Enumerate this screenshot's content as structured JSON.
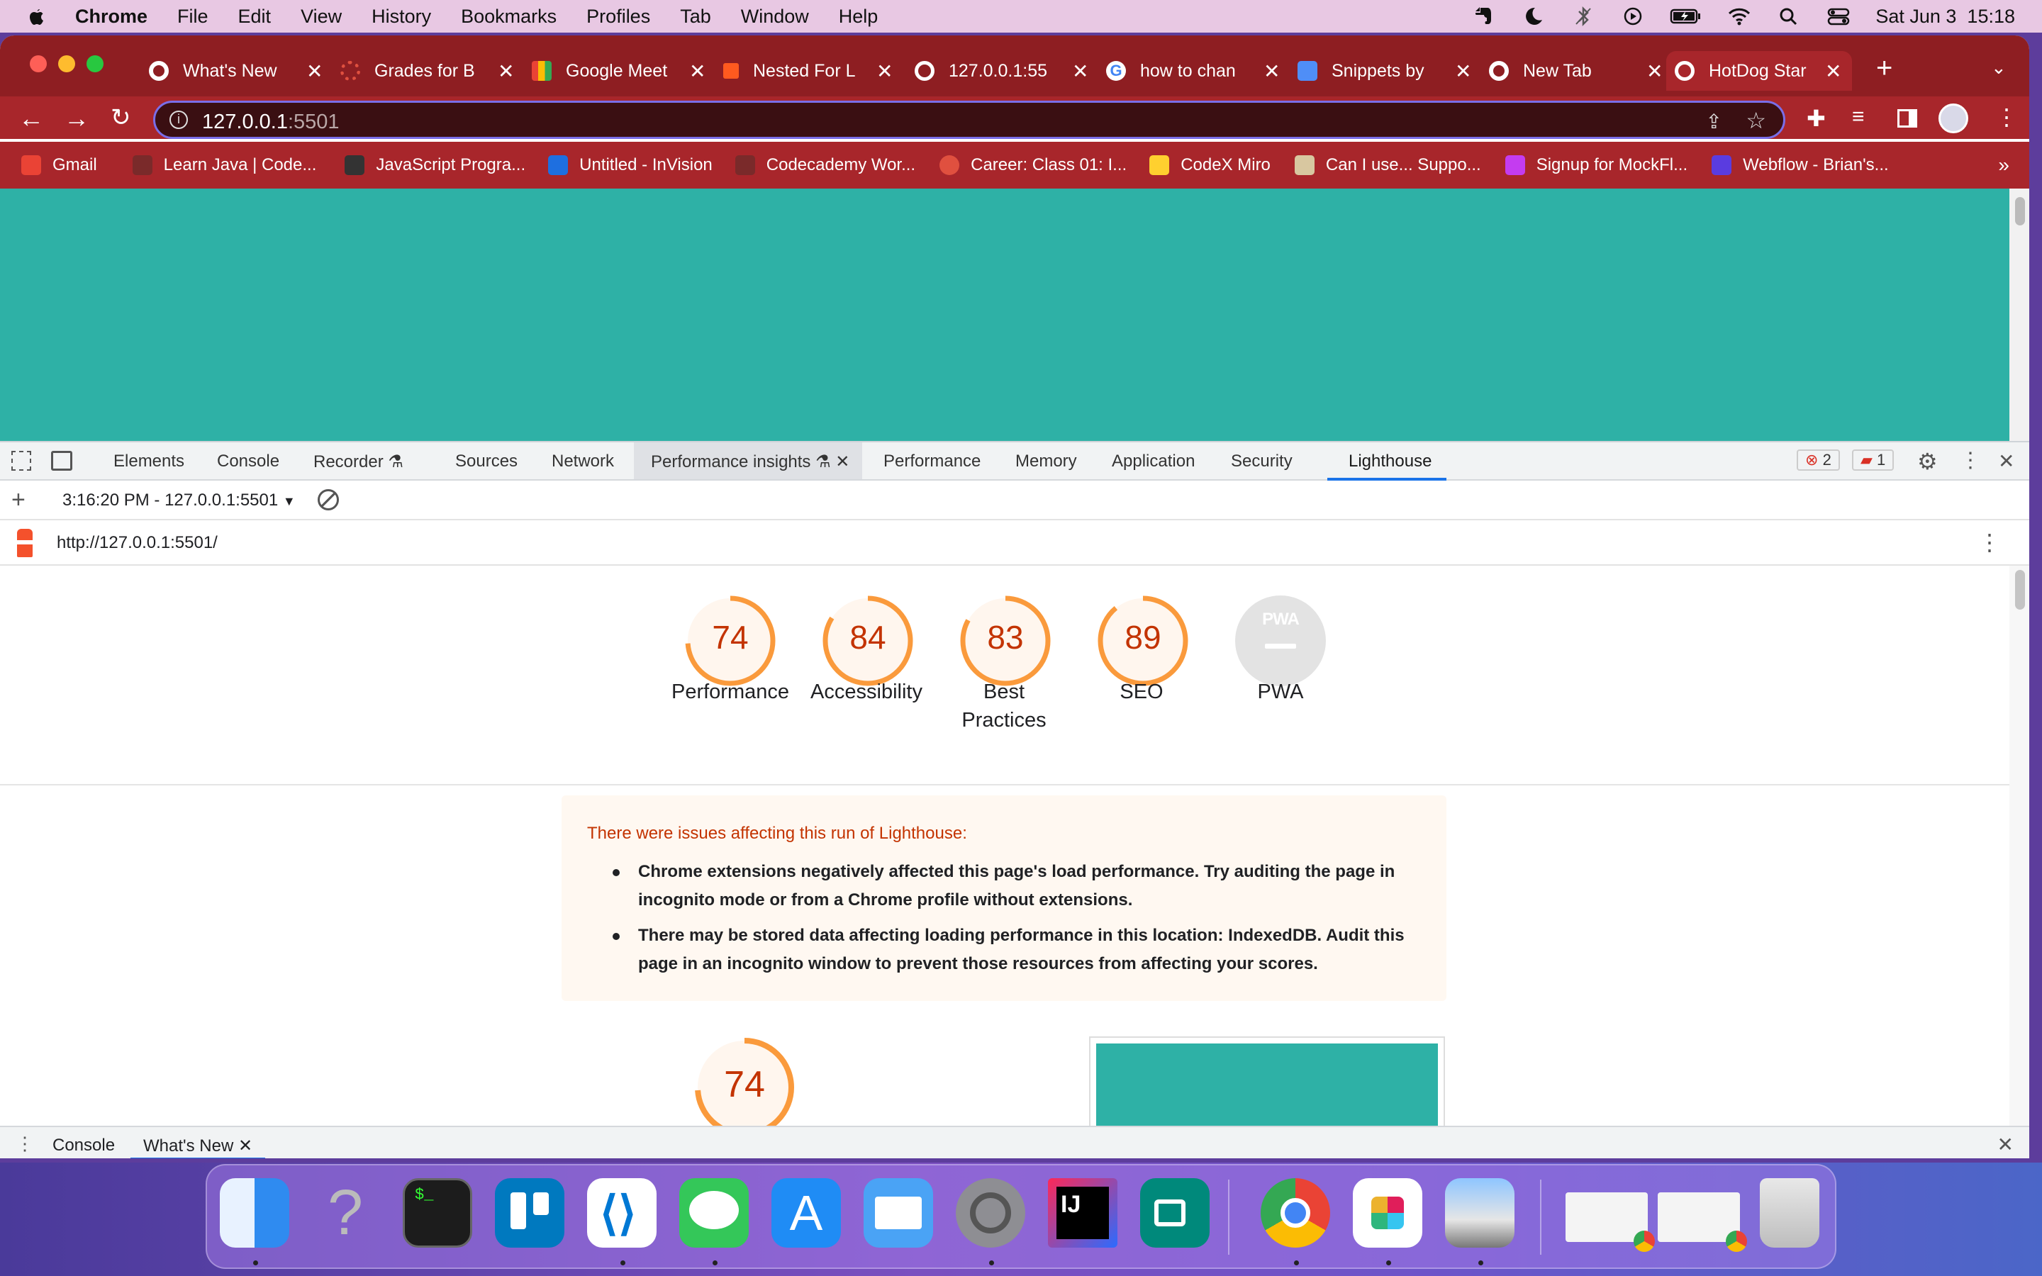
{
  "menubar": {
    "app": "Chrome",
    "items": [
      "File",
      "Edit",
      "View",
      "History",
      "Bookmarks",
      "Profiles",
      "Tab",
      "Window",
      "Help"
    ],
    "clock": "Sat Jun 3  15:18"
  },
  "tabs": [
    {
      "title": "What's New",
      "color": "#ffffff"
    },
    {
      "title": "Grades for B",
      "color": "#e0503f"
    },
    {
      "title": "Google Meet",
      "color": "#34a853"
    },
    {
      "title": "Nested For L",
      "color": "#ff5a1f"
    },
    {
      "title": "127.0.0.1:55",
      "color": "#ffffff"
    },
    {
      "title": "how to chan",
      "color": "#ffffff"
    },
    {
      "title": "Snippets by",
      "color": "#4f8ef7"
    },
    {
      "title": "New Tab",
      "color": "#ffffff"
    },
    {
      "title": "HotDog Star",
      "color": "#ffffff"
    }
  ],
  "address": {
    "host": "127.0.0.1",
    "port": ":5501"
  },
  "bookmarks": [
    {
      "label": "Gmail",
      "color": "#ea4335"
    },
    {
      "label": "Learn Java | Code...",
      "color": "#7a2a2a"
    },
    {
      "label": "JavaScript Progra...",
      "color": "#333333"
    },
    {
      "label": "Untitled - InVision",
      "color": "#1e6fe0"
    },
    {
      "label": "Codecademy Wor...",
      "color": "#7a2a2a"
    },
    {
      "label": "Career: Class 01: I...",
      "color": "#e0503f"
    },
    {
      "label": "CodeX Miro",
      "color": "#ffd02f"
    },
    {
      "label": "Can I use... Suppo...",
      "color": "#d8c7a0"
    },
    {
      "label": "Signup for MockFl...",
      "color": "#c43cf0"
    },
    {
      "label": "Webflow - Brian's...",
      "color": "#5a3ce0"
    }
  ],
  "devtools": {
    "tabs": [
      "Elements",
      "Console",
      "Recorder",
      "Sources",
      "Network",
      "Performance insights",
      "Performance",
      "Memory",
      "Application",
      "Security",
      "Lighthouse"
    ],
    "errors": "2",
    "warnings": "1",
    "report_select": "3:16:20 PM - 127.0.0.1:5501",
    "url": "http://127.0.0.1:5501/"
  },
  "scores": [
    {
      "value": "74",
      "label": "Performance",
      "fraction": 0.74
    },
    {
      "value": "84",
      "label": "Accessibility",
      "fraction": 0.84
    },
    {
      "value": "83",
      "label": "Best\nPractices",
      "fraction": 0.83
    },
    {
      "value": "89",
      "label": "SEO",
      "fraction": 0.89
    }
  ],
  "pwa": {
    "label": "PWA",
    "badge": "PWA"
  },
  "warnings": {
    "heading": "There were issues affecting this run of Lighthouse:",
    "items": [
      "Chrome extensions negatively affected this page's load performance. Try auditing the page in incognito mode or from a Chrome profile without extensions.",
      "There may be stored data affecting loading performance in this location: IndexedDB. Audit this page in an incognito window to prevent those resources from affecting your scores."
    ]
  },
  "perf_preview": {
    "value": "74",
    "fraction": 0.74
  },
  "drawer": {
    "tabs": [
      "Console",
      "What's New"
    ]
  }
}
